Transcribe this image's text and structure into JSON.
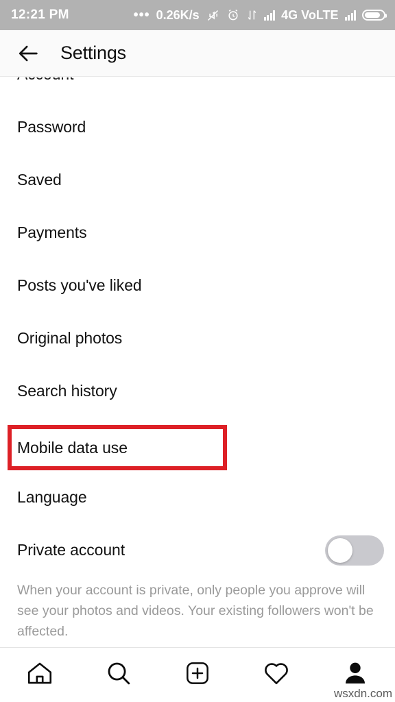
{
  "status_bar": {
    "time": "12:21 PM",
    "dots": "•••",
    "network_speed": "0.26K/s",
    "network_type": "4G VoLTE",
    "icons": [
      "mute-icon",
      "alarm-icon",
      "data-transfer-icon",
      "signal-bars-icon",
      "signal-bars-icon-2",
      "battery-icon"
    ],
    "background_color": "#b2b2b2",
    "text_color": "#ffffff"
  },
  "header": {
    "back_label": "back-arrow",
    "title": "Settings",
    "background_color": "#fafafa"
  },
  "settings_list": {
    "items": [
      {
        "label": "Account",
        "clipped": true
      },
      {
        "label": "Password"
      },
      {
        "label": "Saved"
      },
      {
        "label": "Payments"
      },
      {
        "label": "Posts you've liked"
      },
      {
        "label": "Original photos"
      },
      {
        "label": "Search history"
      },
      {
        "label": "Mobile data use",
        "highlighted": true
      },
      {
        "label": "Language"
      }
    ],
    "private_account": {
      "label": "Private account",
      "toggle_state": "off",
      "toggle_track_color": "#c9c9ce",
      "toggle_knob_color": "#ffffff"
    },
    "helper_text": "When your account is private, only people you approve will see your photos and videos. Your existing followers won't be affected."
  },
  "annotation": {
    "target": "Mobile data use",
    "color": "#dd2026",
    "shape": "rectangle"
  },
  "bottom_nav": {
    "items": [
      {
        "name": "home-icon",
        "active": false
      },
      {
        "name": "search-icon",
        "active": false
      },
      {
        "name": "add-post-icon",
        "active": false
      },
      {
        "name": "activity-heart-icon",
        "active": false
      },
      {
        "name": "profile-icon",
        "active": true
      }
    ]
  },
  "watermark": {
    "text": "wsxdn.com"
  }
}
